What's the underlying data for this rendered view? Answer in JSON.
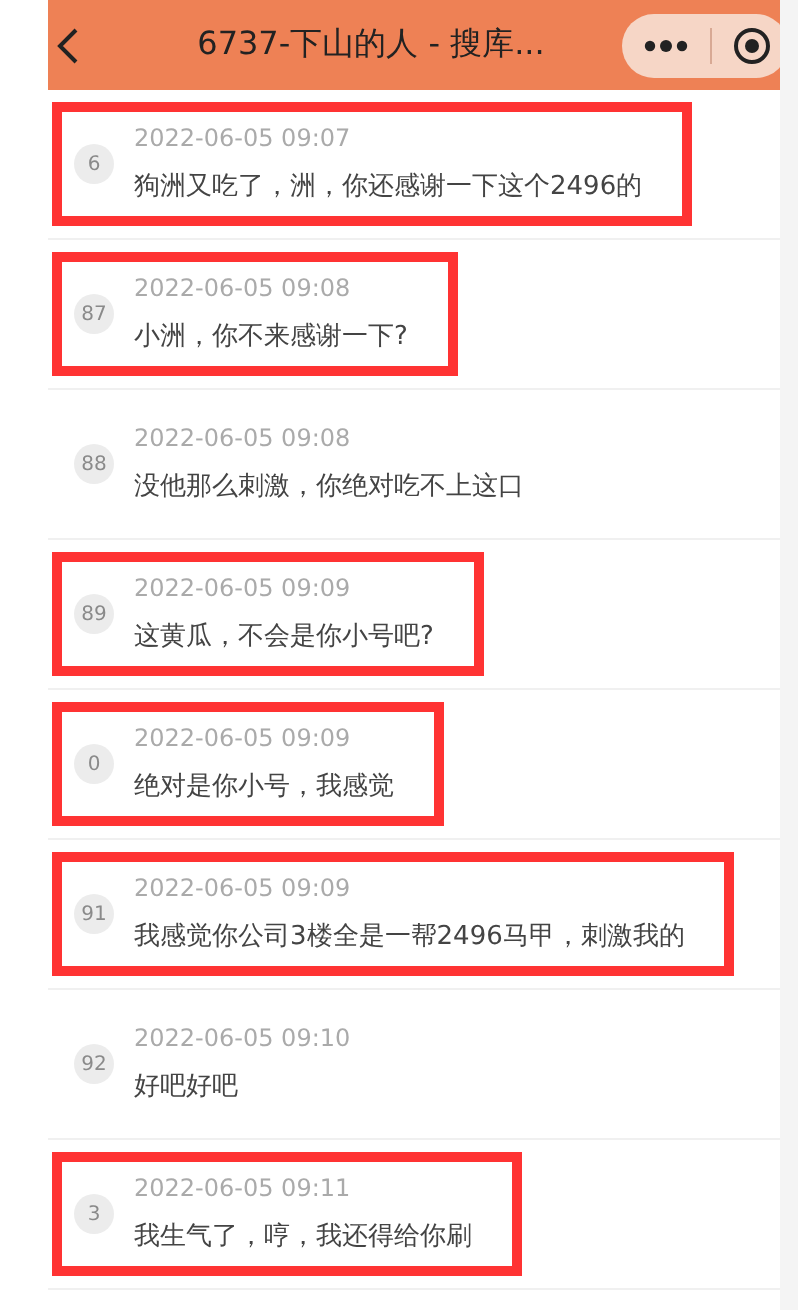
{
  "header": {
    "title": "6737-下山的人 - 搜库..."
  },
  "messages": [
    {
      "number": "6",
      "time": "2022-06-05 09:07",
      "text": "狗洲又吃了，洲，你还感谢一下这个2496的",
      "highlighted": true
    },
    {
      "number": "87",
      "time": "2022-06-05 09:08",
      "text": "小洲，你不来感谢一下?",
      "highlighted": true
    },
    {
      "number": "88",
      "time": "2022-06-05 09:08",
      "text": "没他那么刺激，你绝对吃不上这口",
      "highlighted": false
    },
    {
      "number": "89",
      "time": "2022-06-05 09:09",
      "text": "这黄瓜，不会是你小号吧?",
      "highlighted": true
    },
    {
      "number": "0",
      "time": "2022-06-05 09:09",
      "text": "绝对是你小号，我感觉",
      "highlighted": true
    },
    {
      "number": "91",
      "time": "2022-06-05 09:09",
      "text": "我感觉你公司3楼全是一帮2496马甲，刺激我的",
      "highlighted": true
    },
    {
      "number": "92",
      "time": "2022-06-05 09:10",
      "text": "好吧好吧",
      "highlighted": false
    },
    {
      "number": "3",
      "time": "2022-06-05 09:11",
      "text": "我生气了，哼，我还得给你刷",
      "highlighted": true
    }
  ]
}
